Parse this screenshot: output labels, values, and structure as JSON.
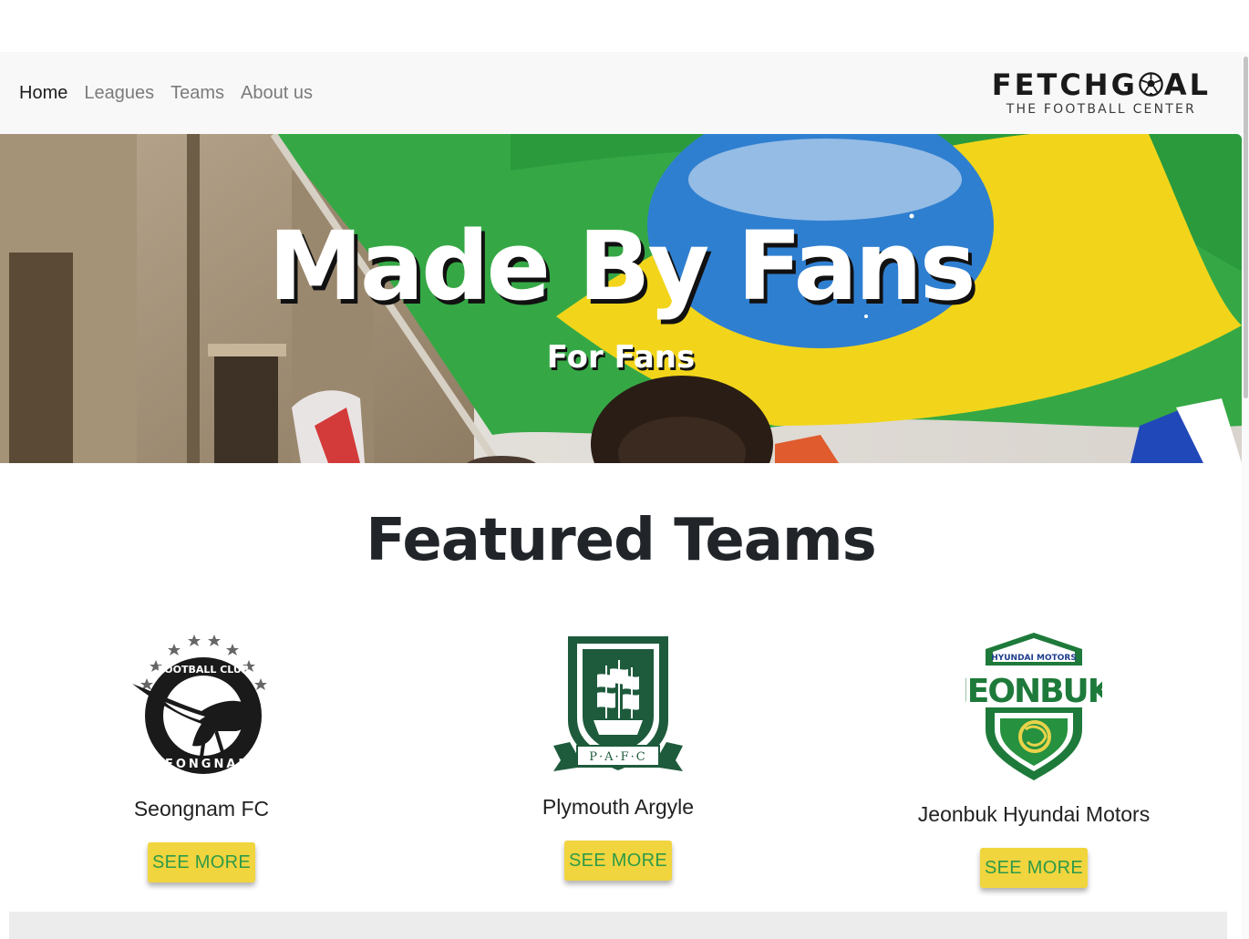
{
  "nav": {
    "links": [
      {
        "label": "Home",
        "active": true
      },
      {
        "label": "Leagues",
        "active": false
      },
      {
        "label": "Teams",
        "active": false
      },
      {
        "label": "About us",
        "active": false
      }
    ],
    "brand": {
      "name_part1": "FETCHG",
      "name_part2": "AL",
      "tagline": "THE FOOTBALL CENTER"
    }
  },
  "hero": {
    "title": "Made By Fans",
    "subtitle": "For Fans"
  },
  "featured": {
    "title": "Featured Teams",
    "teams": [
      {
        "name": "Seongnam FC",
        "button": "SEE MORE",
        "logo_icon": "seongnam-logo-icon",
        "logo_text_top": "FOOTBALL CLUB",
        "logo_text_bottom": "SEONGNAM"
      },
      {
        "name": "Plymouth Argyle",
        "button": "SEE MORE",
        "logo_icon": "plymouth-logo-icon",
        "logo_text": "P·A·F·C"
      },
      {
        "name": "Jeonbuk Hyundai Motors",
        "button": "SEE MORE",
        "logo_icon": "jeonbuk-logo-icon",
        "logo_text_small": "HYUNDAI MOTORS",
        "logo_text_big": "JEONBUK"
      }
    ]
  },
  "colors": {
    "accent_button": "#f1d53e",
    "button_text": "#2e9a48",
    "plymouth_green": "#1e5b3c",
    "jeonbuk_green": "#1e7a3a",
    "navbar_bg": "#f8f8f9"
  }
}
